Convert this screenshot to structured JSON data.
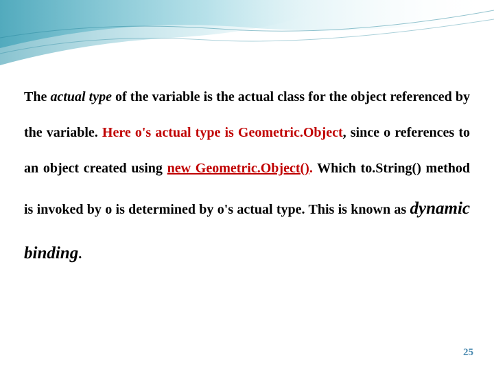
{
  "paragraph": {
    "t1": "The ",
    "t2": "actual type",
    "t3": " of the variable is the actual class for the object referenced by the variable. ",
    "t4": "Here o's actual type is Geometric.Object",
    "t5": ", since o references to an object created using ",
    "t6": "new Geometric.Object()",
    "t7": ". ",
    "t8": "Which to.String() method is invoked by o is determined by o's actual type. This is known as ",
    "t9": "dynamic binding",
    "t10": "."
  },
  "page_number": "25"
}
